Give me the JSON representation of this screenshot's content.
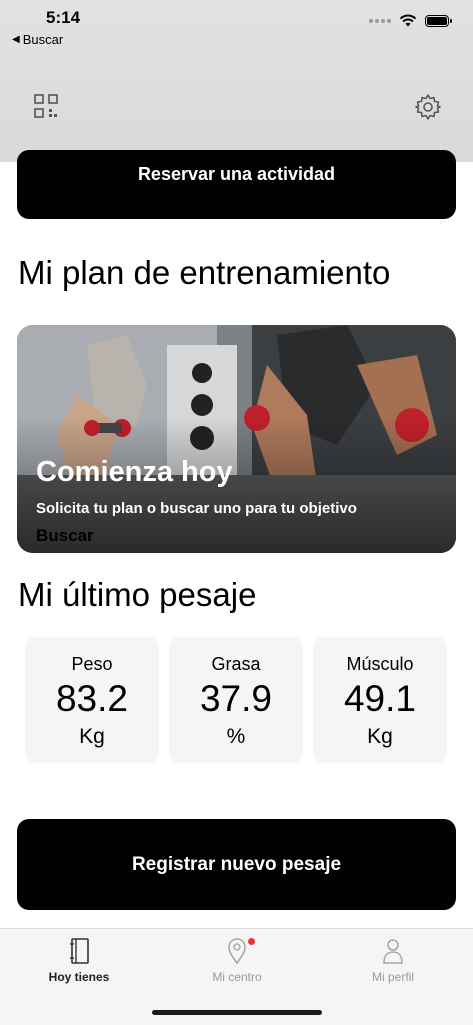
{
  "status_bar": {
    "time": "5:14",
    "back_label": "Buscar"
  },
  "header": {
    "qr_icon": "qr-code-icon",
    "settings_icon": "gear-icon"
  },
  "reserve": {
    "label": "Reservar una actividad"
  },
  "training_plan": {
    "title": "Mi plan de entrenamiento",
    "card_heading": "Comienza hoy",
    "card_subtitle": "Solicita tu plan o buscar uno para tu objetivo",
    "card_link": "Buscar"
  },
  "weigh_in": {
    "title": "Mi último pesaje",
    "stats": [
      {
        "label": "Peso",
        "value": "83.2",
        "unit": "Kg"
      },
      {
        "label": "Grasa",
        "value": "37.9",
        "unit": "%"
      },
      {
        "label": "Músculo",
        "value": "49.1",
        "unit": "Kg"
      }
    ],
    "register_label": "Registrar nuevo pesaje"
  },
  "tabs": [
    {
      "label": "Hoy tienes",
      "icon": "notebook-icon",
      "active": true
    },
    {
      "label": "Mi centro",
      "icon": "location-pin-icon",
      "active": false,
      "badge": true
    },
    {
      "label": "Mi perfil",
      "icon": "person-icon",
      "active": false
    }
  ],
  "colors": {
    "primary": "#000000",
    "card_bg": "#f5f5f5",
    "badge": "#e53935",
    "inactive": "#9a9a9a"
  }
}
